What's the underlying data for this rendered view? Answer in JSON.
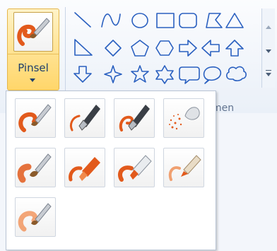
{
  "toolbar": {
    "brushes_label": "Pinsel",
    "shapes_group_label_visible": "men"
  },
  "brush_panel": {
    "items": [
      {
        "icon": "brush-icon"
      },
      {
        "icon": "calligraphy-brush-1-icon"
      },
      {
        "icon": "calligraphy-brush-2-icon"
      },
      {
        "icon": "airbrush-icon"
      },
      {
        "icon": "oil-brush-icon"
      },
      {
        "icon": "crayon-icon"
      },
      {
        "icon": "marker-icon"
      },
      {
        "icon": "natural-pencil-icon"
      },
      {
        "icon": "watercolor-brush-icon"
      }
    ]
  },
  "shapes": [
    "line",
    "curve",
    "oval",
    "rectangle",
    "rounded-rectangle",
    "polygon",
    "triangle",
    "right-triangle",
    "diamond",
    "pentagon",
    "hexagon",
    "right-arrow",
    "left-arrow",
    "up-arrow",
    "down-arrow",
    "four-point-star",
    "five-point-star",
    "six-point-star",
    "rounded-rectangular-callout",
    "oval-callout",
    "cloud-callout"
  ],
  "colors": {
    "accent_orange": "#e25a1c",
    "shape_outline": "#2a60c0",
    "selected_border": "#e5b64a"
  }
}
